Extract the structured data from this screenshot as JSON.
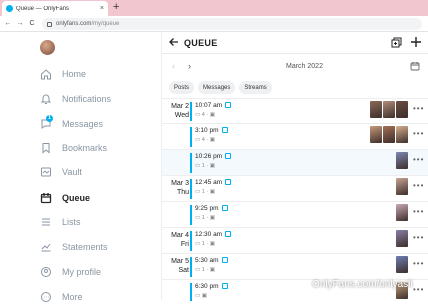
{
  "browser": {
    "tab_title": "Queue — OnlyFans",
    "tab_close": "×",
    "new_tab": "+",
    "back": "←",
    "forward": "→",
    "reload": "C",
    "url_host": "onlyfans.com",
    "url_path": "/my/queue"
  },
  "sidebar": {
    "items": [
      {
        "label": "Home",
        "icon": "home-icon"
      },
      {
        "label": "Notifications",
        "icon": "bell-icon"
      },
      {
        "label": "Messages",
        "icon": "message-icon",
        "badge": "1"
      },
      {
        "label": "Bookmarks",
        "icon": "bookmark-icon"
      },
      {
        "label": "Vault",
        "icon": "vault-icon"
      },
      {
        "label": "Queue",
        "icon": "calendar-icon",
        "active": true
      },
      {
        "label": "Lists",
        "icon": "list-icon"
      },
      {
        "label": "Statements",
        "icon": "chart-icon"
      },
      {
        "label": "My profile",
        "icon": "profile-icon"
      },
      {
        "label": "More",
        "icon": "more-icon"
      }
    ]
  },
  "header": {
    "title": "QUEUE"
  },
  "month": {
    "label": "March 2022",
    "prev": "‹",
    "next": "›"
  },
  "filters": [
    "Posts",
    "Messages",
    "Streams"
  ],
  "queue": [
    {
      "date": "Mar 2",
      "weekday": "Wed",
      "time": "10:07 am",
      "meta": "4 · ",
      "thumbs": [
        "#8a6a5a",
        "#b08d7a",
        "#6b4e42"
      ]
    },
    {
      "time": "3:10 pm",
      "meta": "4 · ",
      "thumbs": [
        "#c79a7b",
        "#a37156",
        "#d7b08f"
      ]
    },
    {
      "time": "10:26 pm",
      "meta": "1 · ",
      "thumbs": [
        "#7d88b3"
      ],
      "highlight": true
    },
    {
      "date": "Mar 3",
      "weekday": "Thu",
      "time": "12:45 am",
      "meta": "1 · ",
      "thumbs": [
        "#c8a393"
      ]
    },
    {
      "time": "9:25 pm",
      "meta": "1 · ",
      "thumbs": [
        "#c9a9b7"
      ]
    },
    {
      "date": "Mar 4",
      "weekday": "Fri",
      "time": "12:30 am",
      "meta": "1 · ",
      "thumbs": [
        "#8a7fa6"
      ]
    },
    {
      "date": "Mar 5",
      "weekday": "Sat",
      "time": "5:30 am",
      "meta": "1 · ",
      "thumbs": [
        "#6d7fb5"
      ]
    },
    {
      "time": "6:30 pm",
      "meta": "",
      "thumbs": [
        "#c8a47f"
      ]
    }
  ],
  "watermark": "OnlyFans.com/onlyasli",
  "colors": {
    "accent": "#00aff0",
    "tab_strip": "#f2c6cf"
  }
}
